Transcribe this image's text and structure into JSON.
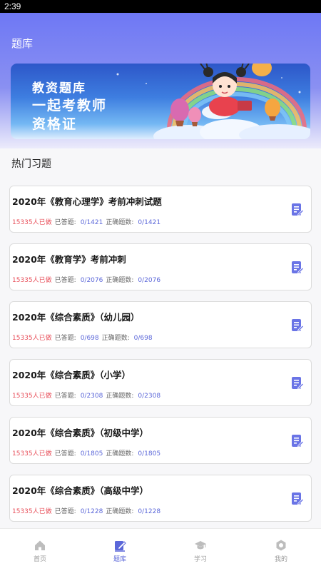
{
  "status_bar": {
    "time": "2:39"
  },
  "header": {
    "title": "题库"
  },
  "banner": {
    "line1": "教资题库",
    "line2": "一起考教师",
    "line3": "资格证"
  },
  "section": {
    "title": "热门习题"
  },
  "exercises": [
    {
      "title": "2020年《教育心理学》考前冲刺试题",
      "done": "15335人已做",
      "answered_label": "已答题:",
      "answered": "0/1421",
      "correct_label": "正确题数:",
      "correct": "0/1421"
    },
    {
      "title": "2020年《教育学》考前冲刺",
      "done": "15335人已做",
      "answered_label": "已答题:",
      "answered": "0/2076",
      "correct_label": "正确题数:",
      "correct": "0/2076"
    },
    {
      "title": "2020年《综合素质》（幼儿园）",
      "done": "15335人已做",
      "answered_label": "已答题:",
      "answered": "0/698",
      "correct_label": "正确题数:",
      "correct": "0/698"
    },
    {
      "title": "2020年《综合素质》（小学）",
      "done": "15335人已做",
      "answered_label": "已答题:",
      "answered": "0/2308",
      "correct_label": "正确题数:",
      "correct": "0/2308"
    },
    {
      "title": "2020年《综合素质》（初级中学）",
      "done": "15335人已做",
      "answered_label": "已答题:",
      "answered": "0/1805",
      "correct_label": "正确题数:",
      "correct": "0/1805"
    },
    {
      "title": "2020年《综合素质》（高级中学）",
      "done": "15335人已做",
      "answered_label": "已答题:",
      "answered": "0/1228",
      "correct_label": "正确题数:",
      "correct": "0/1228"
    }
  ],
  "tabbar": {
    "items": [
      {
        "label": "首页",
        "icon": "home-icon"
      },
      {
        "label": "题库",
        "icon": "edit-icon",
        "active": true
      },
      {
        "label": "学习",
        "icon": "graduation-cap-icon"
      },
      {
        "label": "我的",
        "icon": "profile-icon"
      }
    ]
  },
  "colors": {
    "accent": "#5b67d9",
    "done_text": "#e8505b",
    "header_gradient_top": "#6e78f4"
  }
}
